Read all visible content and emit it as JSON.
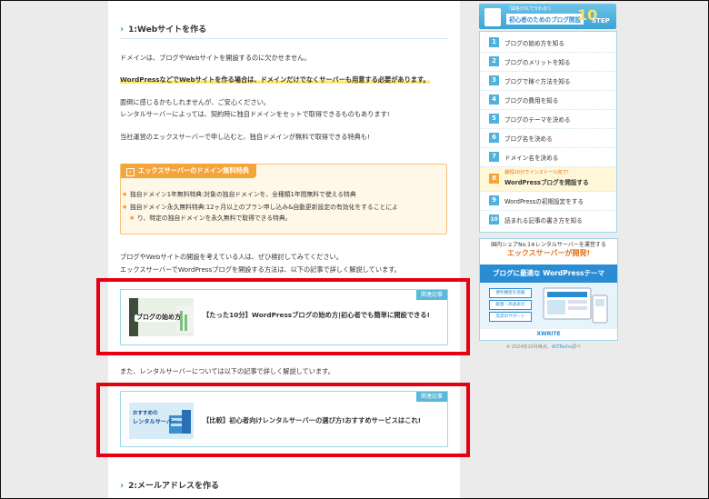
{
  "article": {
    "section1_title": "1:Webサイトを作る",
    "p1": "ドメインは、ブログやWebサイトを開設するのに欠かせません。",
    "p2": "WordPressなどでWebサイトを作る場合は、ドメインだけでなくサーバーも用意する必要があります。",
    "p3a": "面倒に感じるかもしれませんが、ご安心ください。",
    "p3b": "レンタルサーバーによっては、契約時に独自ドメインをセットで取得できるものもあります!",
    "p4": "当社運営のエックスサーバーで申し込むと、独自ドメインが無料で取得できる特典も!",
    "box_title": "エックスサーバーのドメイン無料特典",
    "box_items": [
      "独自ドメイン1年無料特典:対象の独自ドメインを、全種類1年間無料で使える特典",
      "独自ドメイン永久無料特典:12ヶ月以上のプラン申し込み&自動更新設定の有効化をすることによ",
      "り、特定の独自ドメインを永久無料で取得できる特典。"
    ],
    "p5a": "ブログやWebサイトの開設を考えている人は、ぜひ検討してみてください。",
    "p5b": "エックスサーバーでWordPressブログを開設する方法は、以下の記事で詳しく解説しています。",
    "card1": {
      "tag": "関連記事",
      "thumb_text": "ブログの始め方",
      "title": "【たった10分】WordPressブログの始め方|初心者でも簡単に開設できる!"
    },
    "p6": "また、レンタルサーバーについては以下の記事で詳しく解説しています。",
    "card2": {
      "tag": "関連記事",
      "thumb_text_1": "おすすめの",
      "thumb_text_2": "レンタルサーバー",
      "title": "【比較】初心者向けレンタルサーバーの選び方!おすすめサービスはこれ!"
    },
    "section2_title": "2:メールアドレスを作る"
  },
  "sidebar": {
    "head_small": "「図各が丸で分わる!」",
    "head_main": "初心者のためのブログ開設",
    "head_num": "10",
    "head_step": "STEP",
    "items": [
      {
        "num": "1",
        "label": "ブログの始め方を知る"
      },
      {
        "num": "2",
        "label": "ブログのメリットを知る"
      },
      {
        "num": "3",
        "label": "ブログで稼ぐ方法を知る"
      },
      {
        "num": "4",
        "label": "ブログの費用を知る"
      },
      {
        "num": "5",
        "label": "ブログのテーマを決める"
      },
      {
        "num": "6",
        "label": "ブログ名を決める"
      },
      {
        "num": "7",
        "label": "ドメイン名を決める"
      },
      {
        "num": "8",
        "label": "WordPressブログを開設する",
        "sub": "最短10分でインストール完了!"
      },
      {
        "num": "9",
        "label": "WordPressの初期設定をする"
      },
      {
        "num": "10",
        "label": "読まれる記事の書き方を知る"
      }
    ],
    "ad": {
      "line1": "国内シェアNo.1※レンタルサーバーを運営する",
      "line2": "エックスサーバーが開発!",
      "band": "ブログに最適な WordPressテーマ",
      "pills": [
        "便利機能を搭載",
        "軽量・高速表示",
        "充実のサポート"
      ],
      "brand": "XWRITE",
      "note_prefix": "※ 2024年10月時点、",
      "note_link": "W3Techs",
      "note_suffix": "調べ"
    }
  },
  "colors": {
    "accent": "#2a9ad6",
    "highlight": "#ffe76a",
    "box_orange": "#f5a43a",
    "red_frame": "#e60012"
  }
}
